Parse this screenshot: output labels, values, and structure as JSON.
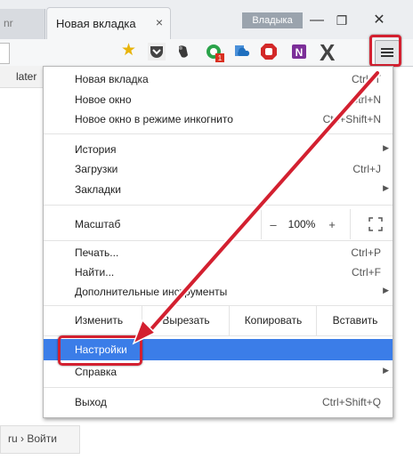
{
  "tabs": {
    "prev_tab_label": "nr",
    "active_tab_title": "Новая вкладка",
    "close_glyph": "×"
  },
  "window": {
    "profile_name": "Владыка",
    "minimize_glyph": "—",
    "maximize_glyph": "❐",
    "close_glyph": "✕"
  },
  "toolbar": {
    "star_icon": "star-icon",
    "extensions": [
      "pocket-icon",
      "evernote-icon",
      "grammarly-icon",
      "cloud-icon",
      "stop-icon",
      "onenote-icon"
    ],
    "ext_x_label": "X",
    "grammarly_badge": "1",
    "onenote_label": "N"
  },
  "page": {
    "later_text": "later",
    "bottom_link": "ru › Войти"
  },
  "menu": {
    "new_tab": {
      "label": "Новая вкладка",
      "shortcut": "Ctrl+T"
    },
    "new_window": {
      "label": "Новое окно",
      "shortcut": "Ctrl+N"
    },
    "incognito": {
      "label": "Новое окно в режиме инкогнито",
      "shortcut": "Ctrl+Shift+N"
    },
    "history": {
      "label": "История",
      "arrow": "▶"
    },
    "downloads": {
      "label": "Загрузки",
      "shortcut": "Ctrl+J"
    },
    "bookmarks": {
      "label": "Закладки",
      "arrow": "▶"
    },
    "zoom": {
      "label": "Масштаб",
      "minus": "–",
      "value": "100%",
      "plus": "+"
    },
    "print": {
      "label": "Печать...",
      "shortcut": "Ctrl+P"
    },
    "find": {
      "label": "Найти...",
      "shortcut": "Ctrl+F"
    },
    "more_tools": {
      "label": "Дополнительные инструменты",
      "arrow": "▶"
    },
    "edit": {
      "label": "Изменить",
      "cut": "Вырезать",
      "copy": "Копировать",
      "paste": "Вставить"
    },
    "settings": {
      "label": "Настройки"
    },
    "help": {
      "label": "Справка",
      "arrow": "▶"
    },
    "exit": {
      "label": "Выход",
      "shortcut": "Ctrl+Shift+Q"
    }
  },
  "colors": {
    "highlight_red": "#d32030",
    "selected_blue": "#3b7de8"
  }
}
